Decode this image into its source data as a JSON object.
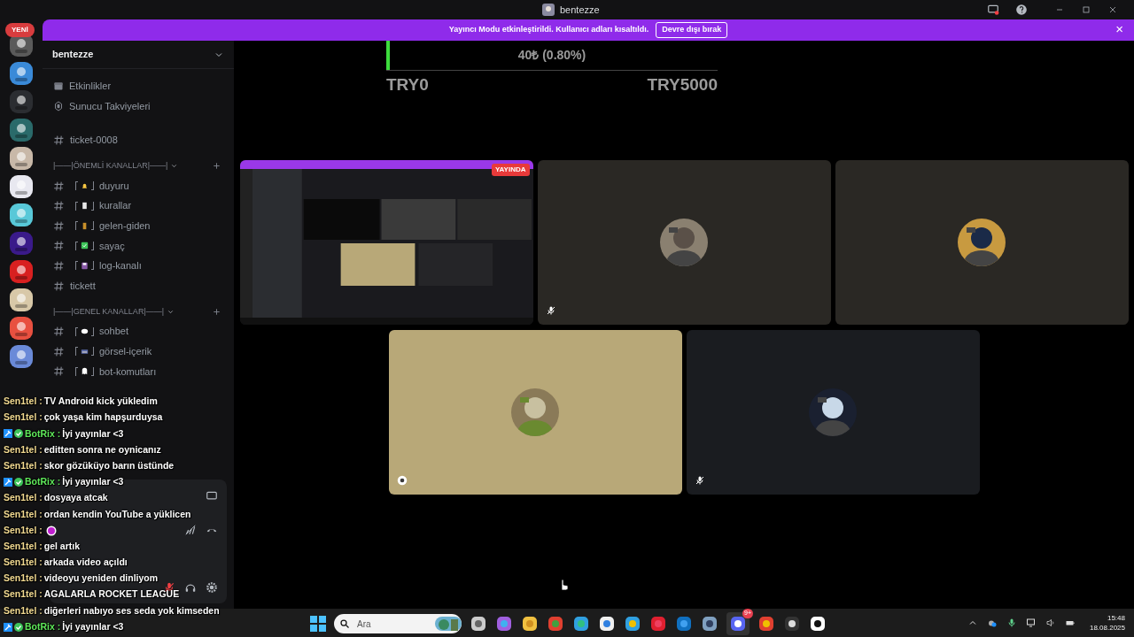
{
  "window": {
    "title": "bentezze"
  },
  "new_badge": "YENİ",
  "banner": {
    "text": "Yayıncı Modu etkinleştirildi. Kullanıcı adları kısaltıldı.",
    "button": "Devre dışı bırak",
    "close": "×"
  },
  "server": {
    "name": "bentezze"
  },
  "sidebar": {
    "items": [
      {
        "kind": "link",
        "label": "Etkinlikler"
      },
      {
        "kind": "link",
        "label": "Sunucu Takviyeleri"
      },
      {
        "kind": "channel",
        "label": "ticket-0008"
      },
      {
        "kind": "category",
        "label": "|——|ÖNEMLİ KANALLAR|——|"
      },
      {
        "kind": "emoji_channel",
        "label": "duyuru"
      },
      {
        "kind": "emoji_channel",
        "label": "kurallar"
      },
      {
        "kind": "emoji_channel",
        "label": "gelen-giden"
      },
      {
        "kind": "emoji_channel",
        "label": "sayaç"
      },
      {
        "kind": "emoji_channel",
        "label": "log-kanalı"
      },
      {
        "kind": "channel",
        "label": "tickett"
      },
      {
        "kind": "category",
        "label": "|——|GENEL KANALLAR|——|"
      },
      {
        "kind": "emoji_channel",
        "label": "sohbet"
      },
      {
        "kind": "emoji_channel",
        "label": "görsel-içerik"
      },
      {
        "kind": "emoji_channel",
        "label": "bot-komutları"
      }
    ]
  },
  "goal": {
    "amount": "40₺ (0.80%)",
    "level": 0.008,
    "min": "TRY0",
    "max": "TRY5000"
  },
  "stream_tiles": [
    {
      "kind": "screen",
      "live_badge": "YAYINDA"
    },
    {
      "kind": "camera",
      "muted": true
    },
    {
      "kind": "camera",
      "muted": false
    },
    {
      "kind": "camera",
      "muted": false,
      "activity": true
    },
    {
      "kind": "camera",
      "muted": true
    }
  ],
  "chat": [
    {
      "kind": "user",
      "user": "Sen1tel :",
      "text": "TV Android kick yükledim"
    },
    {
      "kind": "user",
      "user": "Sen1tel :",
      "text": "çok yaşa kim hapşurduysa"
    },
    {
      "kind": "bot",
      "user": "BotRix :",
      "text": "İyi yayınlar <3"
    },
    {
      "kind": "user",
      "user": "Sen1tel :",
      "text": "editten sonra ne oynicanız"
    },
    {
      "kind": "user",
      "user": "Sen1tel :",
      "text": "skor gözüküyo barın üstünde"
    },
    {
      "kind": "bot",
      "user": "BotRix :",
      "text": "İyi yayınlar <3"
    },
    {
      "kind": "user",
      "user": "Sen1tel :",
      "text": "dosyaya atcak"
    },
    {
      "kind": "user",
      "user": "Sen1tel :",
      "text": "ordan kendin YouTube a yüklicen"
    },
    {
      "kind": "emote",
      "user": "Sen1tel :"
    },
    {
      "kind": "user",
      "user": "Sen1tel :",
      "text": "gel artık"
    },
    {
      "kind": "user",
      "user": "Sen1tel :",
      "text": "arkada video açıldı"
    },
    {
      "kind": "user",
      "user": "Sen1tel :",
      "text": "videoyu yeniden dinliyom"
    },
    {
      "kind": "user",
      "user": "Sen1tel :",
      "text": "AGALARLA ROCKET LEAGUE"
    },
    {
      "kind": "user",
      "user": "Sen1tel :",
      "text": "diğerleri nabıyo ses seda yok kimseden"
    },
    {
      "kind": "bot",
      "user": "BotRix :",
      "text": "İyi yayınlar <3"
    }
  ],
  "taskbar": {
    "search_placeholder": "Ara",
    "discord_badge": "9+",
    "time": "15:48",
    "date": "18.08.2025"
  }
}
